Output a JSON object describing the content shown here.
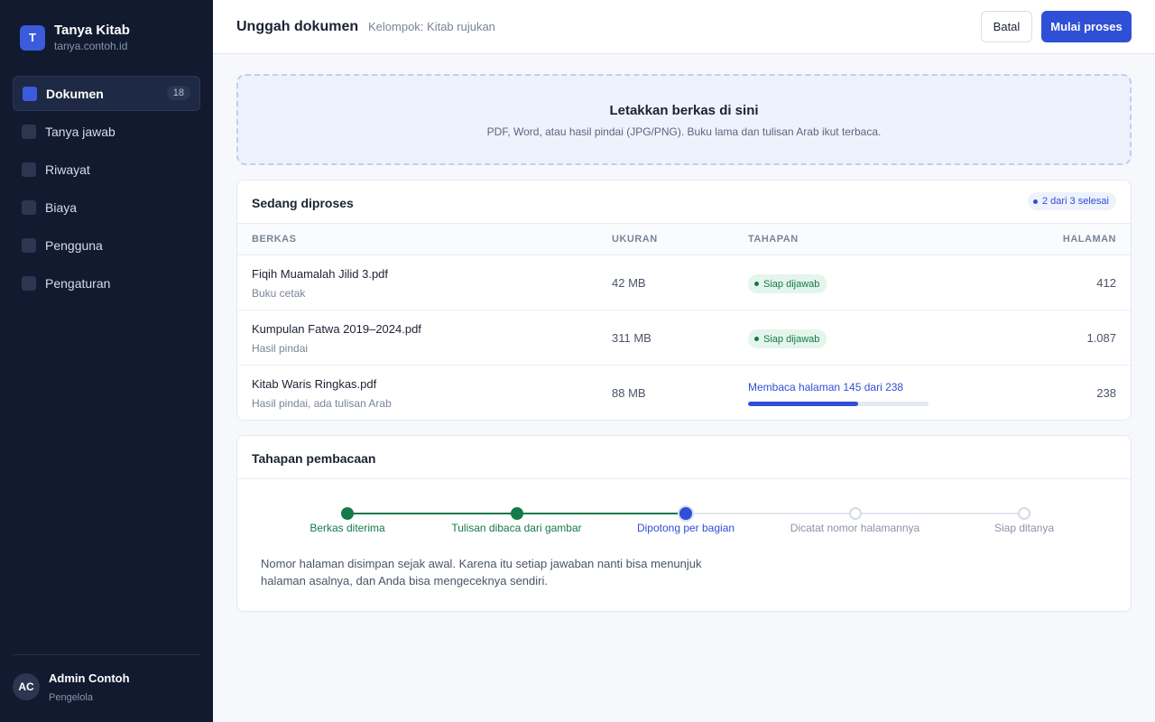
{
  "brand": {
    "initial": "T",
    "name": "Tanya Kitab",
    "domain": "tanya.contoh.id"
  },
  "sidebar": {
    "items": [
      {
        "label": "Dokumen",
        "badge": "18",
        "active": true
      },
      {
        "label": "Tanya jawab"
      },
      {
        "label": "Riwayat"
      },
      {
        "label": "Biaya"
      },
      {
        "label": "Pengguna"
      },
      {
        "label": "Pengaturan"
      }
    ]
  },
  "user": {
    "initials": "AC",
    "name": "Admin Contoh",
    "role": "Pengelola"
  },
  "header": {
    "title": "Unggah dokumen",
    "subtitle": "Kelompok: Kitab rujukan",
    "cancel_label": "Batal",
    "start_label": "Mulai proses"
  },
  "dropzone": {
    "title": "Letakkan berkas di sini",
    "subtitle": "PDF, Word, atau hasil pindai (JPG/PNG). Buku lama dan tulisan Arab ikut terbaca."
  },
  "processing": {
    "title": "Sedang diproses",
    "status": "2 dari 3 selesai",
    "columns": {
      "file": "BERKAS",
      "size": "UKURAN",
      "stage": "TAHAPAN",
      "pages": "HALAMAN"
    },
    "rows": [
      {
        "name": "Fiqih Muamalah Jilid 3.pdf",
        "note": "Buku cetak",
        "size": "42 MB",
        "stage": "Siap dijawab",
        "pages": "412"
      },
      {
        "name": "Kumpulan Fatwa 2019–2024.pdf",
        "note": "Hasil pindai",
        "size": "311 MB",
        "stage": "Siap dijawab",
        "pages": "1.087"
      },
      {
        "name": "Kitab Waris Ringkas.pdf",
        "note": "Hasil pindai, ada tulisan Arab",
        "size": "88 MB",
        "stage": "Membaca halaman 145 dari 238",
        "pages": "238",
        "progress": 0.61
      }
    ]
  },
  "steps": {
    "title": "Tahapan pembacaan",
    "items": [
      {
        "label": "Berkas diterima",
        "state": "done"
      },
      {
        "label": "Tulisan dibaca dari gambar",
        "state": "done"
      },
      {
        "label": "Dipotong per bagian",
        "state": "current"
      },
      {
        "label": "Dicatat nomor halamannya",
        "state": "todo"
      },
      {
        "label": "Siap ditanya",
        "state": "todo"
      }
    ],
    "note": "Nomor halaman disimpan sejak awal. Karena itu setiap jawaban nanti bisa menunjuk halaman asalnya, dan Anda bisa mengeceknya sendiri."
  },
  "colors": {
    "accent": "#2f4fd6",
    "success": "#15794a",
    "sidebar": "#111a2e"
  }
}
